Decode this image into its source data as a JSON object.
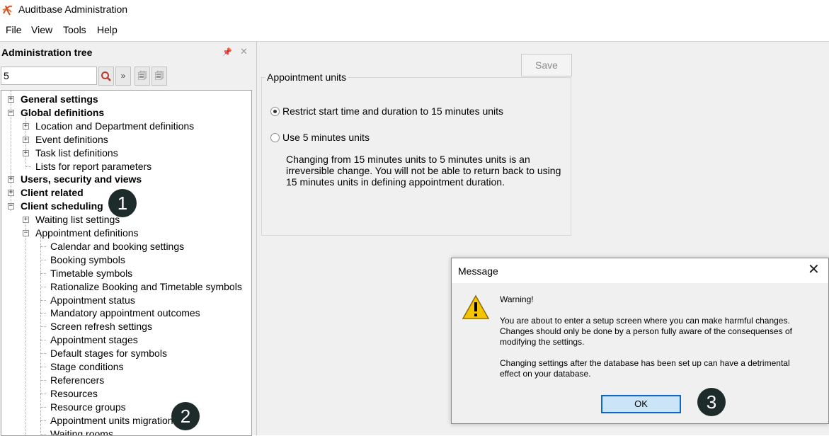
{
  "window": {
    "title": "Auditbase Administration",
    "icon": "auditbase-logo-icon"
  },
  "menu": [
    "File",
    "View",
    "Tools",
    "Help"
  ],
  "left_panel": {
    "title": "Administration tree",
    "search_value": "5",
    "tree": [
      {
        "label": "General settings",
        "bold": true,
        "expander": "+"
      },
      {
        "label": "Global definitions",
        "bold": true,
        "expander": "-"
      },
      {
        "label": "Location and Department definitions",
        "expander": "+"
      },
      {
        "label": "Event definitions",
        "expander": "+"
      },
      {
        "label": "Task list definitions",
        "expander": "+"
      },
      {
        "label": "Lists for report parameters"
      },
      {
        "label": "Users, security and views",
        "bold": true,
        "expander": "+"
      },
      {
        "label": "Client related",
        "bold": true,
        "expander": "+"
      },
      {
        "label": "Client scheduling",
        "bold": true,
        "expander": "-"
      },
      {
        "label": "Waiting list settings",
        "expander": "+"
      },
      {
        "label": "Appointment definitions",
        "expander": "-"
      },
      {
        "label": "Calendar and booking settings"
      },
      {
        "label": "Booking symbols"
      },
      {
        "label": "Timetable symbols"
      },
      {
        "label": "Rationalize Booking and Timetable symbols"
      },
      {
        "label": "Appointment status"
      },
      {
        "label": "Mandatory appointment outcomes"
      },
      {
        "label": "Screen refresh settings"
      },
      {
        "label": "Appointment stages"
      },
      {
        "label": "Default stages for symbols"
      },
      {
        "label": "Stage conditions"
      },
      {
        "label": "Referencers"
      },
      {
        "label": "Resources"
      },
      {
        "label": "Resource groups"
      },
      {
        "label": "Appointment units migration"
      },
      {
        "label": "Waiting rooms"
      }
    ]
  },
  "main": {
    "save_label": "Save",
    "group_title": "Appointment units",
    "option1": "Restrict start time and duration to 15 minutes units",
    "option1_selected": true,
    "option2": "Use 5 minutes units",
    "info": "Changing from 15 minutes units to 5 minutes units is an irreversible change. You will not be able to return back to using 15 minutes units in defining appointment duration."
  },
  "dialog": {
    "title": "Message",
    "heading": "Warning!",
    "para1": "You are about to enter a setup screen where you can make harmful changes. Changes should only be done by a person fully aware of the consequenses of modifying the settings.",
    "para2": "Changing settings after the database has been set up can have a detrimental effect on your database.",
    "ok_label": "OK"
  },
  "callouts": [
    "1",
    "2",
    "3"
  ],
  "colors": {
    "callout_bg": "#1e2b2b",
    "ok_border": "#0a67c4",
    "ok_bg": "#cce4f7",
    "search_accent": "#c0392b"
  }
}
